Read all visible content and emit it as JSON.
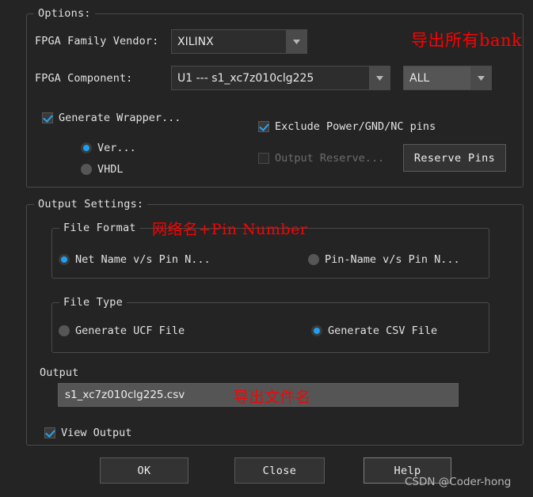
{
  "options_group": {
    "title": "Options:",
    "vendor_label": "FPGA Family Vendor:",
    "vendor_value": "XILINX",
    "component_label": "FPGA Component:",
    "component_value": "U1 --- s1_xc7z010clg225",
    "bank_value": "ALL",
    "generate_wrapper_label": "Generate Wrapper...",
    "generate_wrapper_checked": true,
    "wrapper_lang_verilog": "Ver...",
    "wrapper_lang_vhdl": "VHDL",
    "wrapper_lang_selected": "Ver...",
    "exclude_pins_label": "Exclude Power/GND/NC pins",
    "exclude_pins_checked": true,
    "output_reserve_label": "Output Reserve...",
    "output_reserve_checked": false,
    "output_reserve_disabled": true,
    "reserve_pins_button": "Reserve Pins"
  },
  "output_settings_group": {
    "title": "Output Settings:",
    "file_format": {
      "title": "File Format",
      "option_net_name": "Net Name v/s Pin N...",
      "option_pin_name": "Pin-Name v/s Pin N...",
      "selected": "Net Name v/s Pin N..."
    },
    "file_type": {
      "title": "File Type",
      "option_ucf": "Generate UCF File",
      "option_csv": "Generate CSV File",
      "selected": "Generate CSV File"
    },
    "output_label": "Output",
    "output_filename": "s1_xc7z010clg225.csv",
    "view_output_label": "View Output",
    "view_output_checked": true
  },
  "buttons": {
    "ok": "OK",
    "close": "Close",
    "help": "Help"
  },
  "annotations": {
    "export_all_banks": "导出所有bank",
    "net_name_pin_number": "网络名+Pin Number",
    "export_file_name": "导出文件名"
  },
  "watermark": "CSDN @Coder-hong",
  "colors": {
    "background": "#242424",
    "accent_blue": "#1e9ff2",
    "annotation_red": "#ff0000",
    "groupbox_border": "#4a4a4a",
    "field_dark": "#2d2d2d",
    "field_light": "#555555"
  }
}
